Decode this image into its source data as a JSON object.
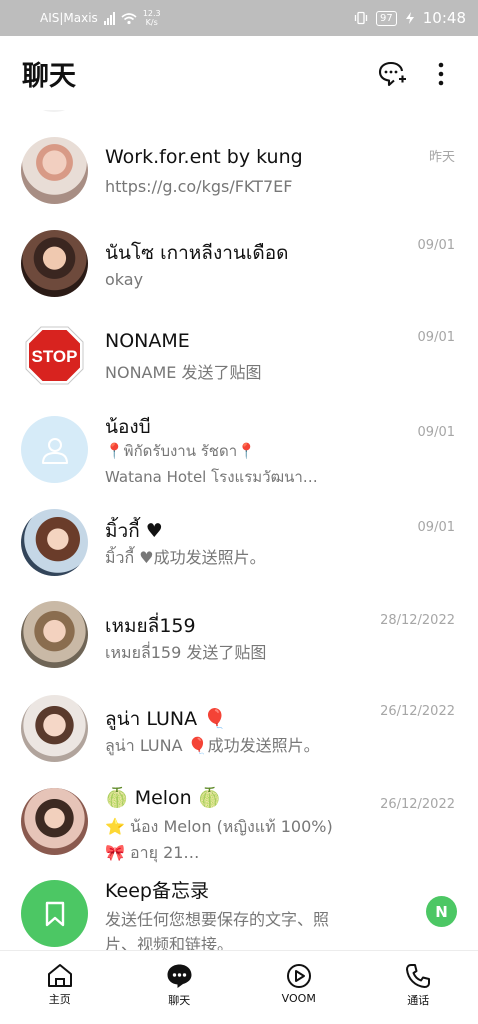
{
  "status_bar": {
    "carrier": "AIS|Maxis",
    "speed_value": "12.3",
    "speed_unit": "K/s",
    "battery": "97",
    "time": "10:48"
  },
  "header": {
    "title": "聊天",
    "new_chat_icon": "chat-plus-icon",
    "more_icon": "more-vertical-icon"
  },
  "chats": [
    {
      "name": "Work.for.ent by kung",
      "preview": "https://g.co/kgs/FKT7EF",
      "time": "昨天",
      "avatar": "photo"
    },
    {
      "name": "นันโซ เกาหลีงานเดือด",
      "preview": "okay",
      "time": "09/01",
      "avatar": "photo"
    },
    {
      "name": "NONAME",
      "preview": "NONAME 发送了贴图",
      "time": "09/01",
      "avatar": "stop-sign",
      "avatar_text": "STOP"
    },
    {
      "name": "น้องบี",
      "preview_line1": "📍พิกัดรับงาน รัชดา📍",
      "preview_line2": "Watana Hotel โรงแรมวัฒนา…",
      "time": "09/01",
      "avatar": "default-person-icon"
    },
    {
      "name": "มิ้วกี้ ♥",
      "preview": "มิ้วกี้ ♥成功发送照片。",
      "time": "09/01",
      "avatar": "photo"
    },
    {
      "name": "เหมยลี่159",
      "preview": "เหมยลี่159 发送了贴图",
      "time": "28/12/2022",
      "avatar": "photo"
    },
    {
      "name": "ลูน่า LUNA 🎈",
      "preview": "ลูน่า LUNA 🎈成功发送照片。",
      "time": "26/12/2022",
      "avatar": "photo"
    },
    {
      "name": "🍈 Melon 🍈",
      "preview_line1": "⭐ น้อง Melon (หญิงแท้ 100%)",
      "preview_line2": "🎀 อายุ 21…",
      "time": "26/12/2022",
      "avatar": "photo"
    },
    {
      "name": "Keep备忘录",
      "preview": "发送任何您想要保存的文字、照片、视频和链接。",
      "badge": "N",
      "avatar": "bookmark-icon"
    }
  ],
  "bottom_nav": [
    {
      "label": "主页",
      "icon": "home-icon"
    },
    {
      "label": "聊天",
      "icon": "chat-icon",
      "active": true
    },
    {
      "label": "VOOM",
      "icon": "voom-icon"
    },
    {
      "label": "通话",
      "icon": "phone-icon"
    }
  ],
  "colors": {
    "status_bar": "#bdbdbd",
    "accent_green": "#4cc764",
    "time_text": "#a6a6a6",
    "preview_text": "#777777"
  }
}
